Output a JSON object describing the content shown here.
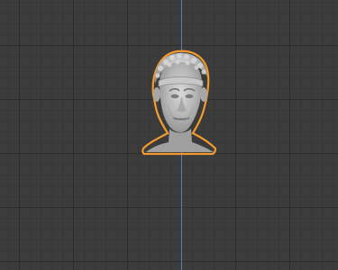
{
  "viewport": {
    "name": "3D viewport",
    "background_color": "#3c3c3c",
    "grid_color": "#2f2f2f",
    "y_axis_color": "#5f86c8"
  },
  "selection": {
    "object_type": "head bust",
    "outline_color": "#f29a2e",
    "mesh_color": "#b8b8b8",
    "selected": true
  }
}
